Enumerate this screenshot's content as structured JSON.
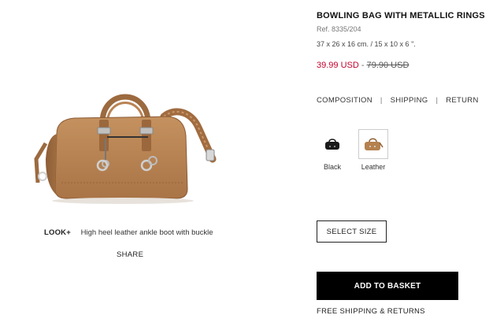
{
  "product": {
    "title": "BOWLING BAG WITH METALLIC RINGS",
    "ref": "Ref. 8335/204",
    "dimensions": "37 x 26 x 16 cm. / 15 x 10 x 6 \".",
    "price_sale": "39.99 USD",
    "price_separator": " - ",
    "price_original": "79.90 USD",
    "image_icon": "leather-bowling-bag-image"
  },
  "info_links": {
    "composition": "COMPOSITION",
    "shipping": "SHIPPING",
    "return": "RETURN",
    "separator": "|"
  },
  "colors": {
    "options": [
      {
        "name": "Black",
        "selected": false,
        "color": "#1a1a1a"
      },
      {
        "name": "Leather",
        "selected": true,
        "color": "#b5814f"
      }
    ]
  },
  "look": {
    "label": "LOOK+",
    "item": "High heel leather ankle boot with buckle"
  },
  "share_label": "SHARE",
  "buttons": {
    "select_size": "SELECT SIZE",
    "add_to_basket": "ADD TO BASKET"
  },
  "free_shipping": "FREE SHIPPING & RETURNS",
  "theme": {
    "sale_color": "#c4002b",
    "primary_button_bg": "#000000",
    "leather_color": "#b5814f"
  }
}
